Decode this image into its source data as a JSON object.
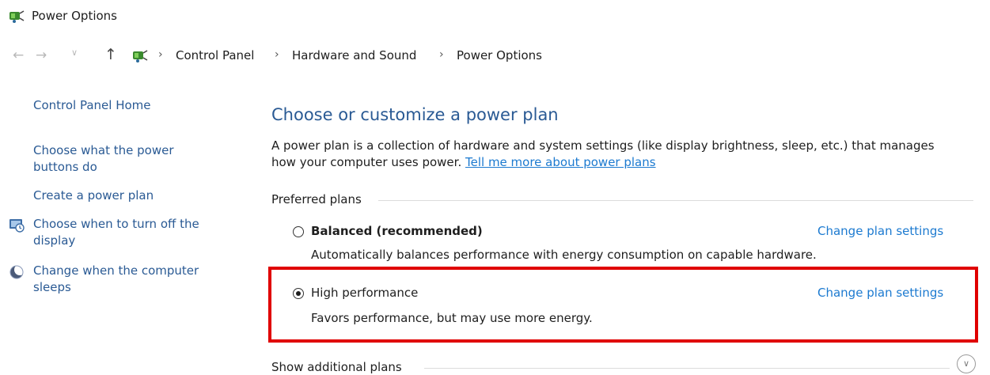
{
  "window": {
    "title": "Power Options",
    "icon": "power-options-icon"
  },
  "addressbar": {
    "back_icon": "back-arrow-icon",
    "forward_icon": "forward-arrow-icon",
    "history_icon": "chevron-down-icon",
    "up_icon": "up-arrow-icon",
    "separator": "›",
    "breadcrumbs": [
      "Control Panel",
      "Hardware and Sound",
      "Power Options"
    ]
  },
  "sidebar": {
    "home": "Control Panel Home",
    "links": [
      {
        "label_line1": "Choose what the power",
        "label_line2": "buttons do"
      },
      {
        "label_line1": "Create a power plan"
      },
      {
        "label_line1": "Choose when to turn off the",
        "label_line2": "display",
        "icon": "monitor-icon"
      },
      {
        "label_line1": "Change when the computer",
        "label_line2": "sleeps",
        "icon": "moon-icon"
      }
    ]
  },
  "main": {
    "heading": "Choose or customize a power plan",
    "description_line1": "A power plan is a collection of hardware and system settings (like display brightness, sleep, etc.) that manages",
    "description_line2": "how your computer uses power.",
    "description_link": "Tell me more about power plans",
    "preferred_label": "Preferred plans",
    "plans": [
      {
        "name": "Balanced (recommended)",
        "description": "Automatically balances performance with energy consumption on capable hardware.",
        "selected": false,
        "link": "Change plan settings"
      },
      {
        "name": "High performance",
        "description": "Favors performance, but may use more energy.",
        "selected": true,
        "link": "Change plan settings"
      }
    ],
    "additional_label": "Show additional plans",
    "expand_icon": "chevron-down-circle-icon"
  },
  "colors": {
    "link": "#1c7ad0",
    "sidebar_link": "#2a5a94",
    "heading": "#2a5a94",
    "highlight": "#e00000"
  }
}
